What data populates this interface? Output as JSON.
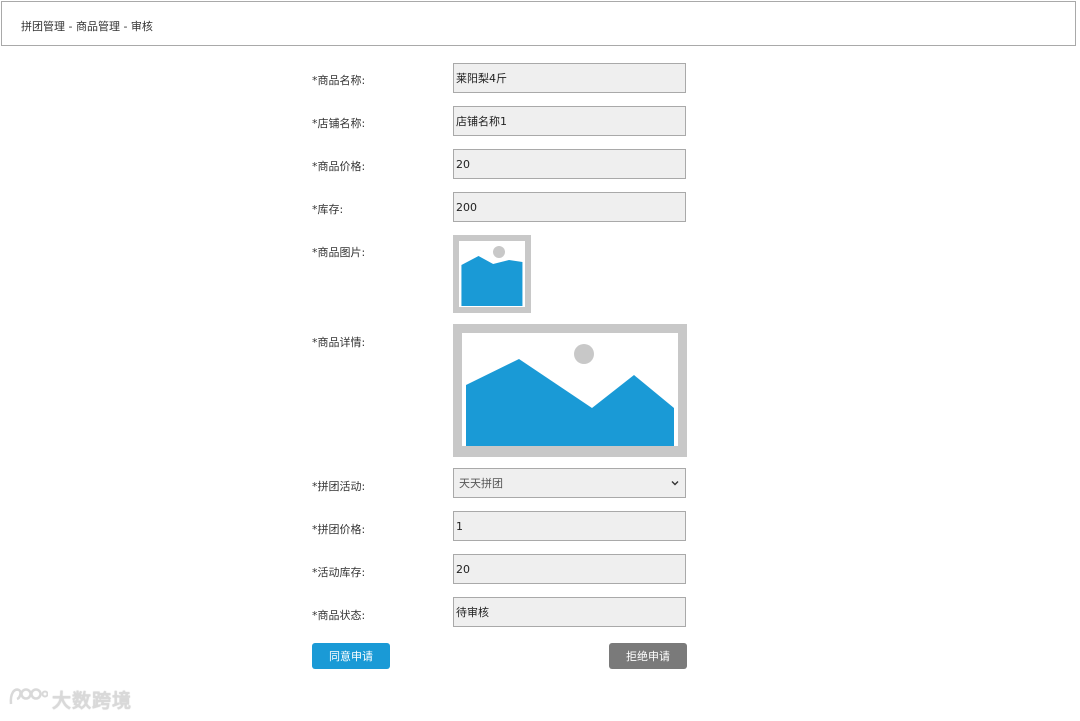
{
  "breadcrumb": "拼团管理 - 商品管理 - 审核",
  "form": {
    "product_name": {
      "label": "*商品名称:",
      "value": "莱阳梨4斤"
    },
    "shop_name": {
      "label": "*店铺名称:",
      "value": "店铺名称1"
    },
    "price": {
      "label": "*商品价格:",
      "value": "20"
    },
    "stock": {
      "label": "*库存:",
      "value": "200"
    },
    "image": {
      "label": "*商品图片:"
    },
    "detail": {
      "label": "*商品详情:"
    },
    "group_activity": {
      "label": "*拼团活动:",
      "value": "天天拼团"
    },
    "group_price": {
      "label": "*拼团价格:",
      "value": "1"
    },
    "activity_stock": {
      "label": "*活动库存:",
      "value": "20"
    },
    "status": {
      "label": "*商品状态:",
      "value": "待审核"
    }
  },
  "buttons": {
    "approve": "同意申请",
    "reject": "拒绝申请"
  },
  "watermark": "大数跨境",
  "colors": {
    "primary": "#1a9ad6",
    "reject": "#7a7a7a",
    "field_bg": "#efefef",
    "placeholder_frame": "#c8c8c8"
  }
}
